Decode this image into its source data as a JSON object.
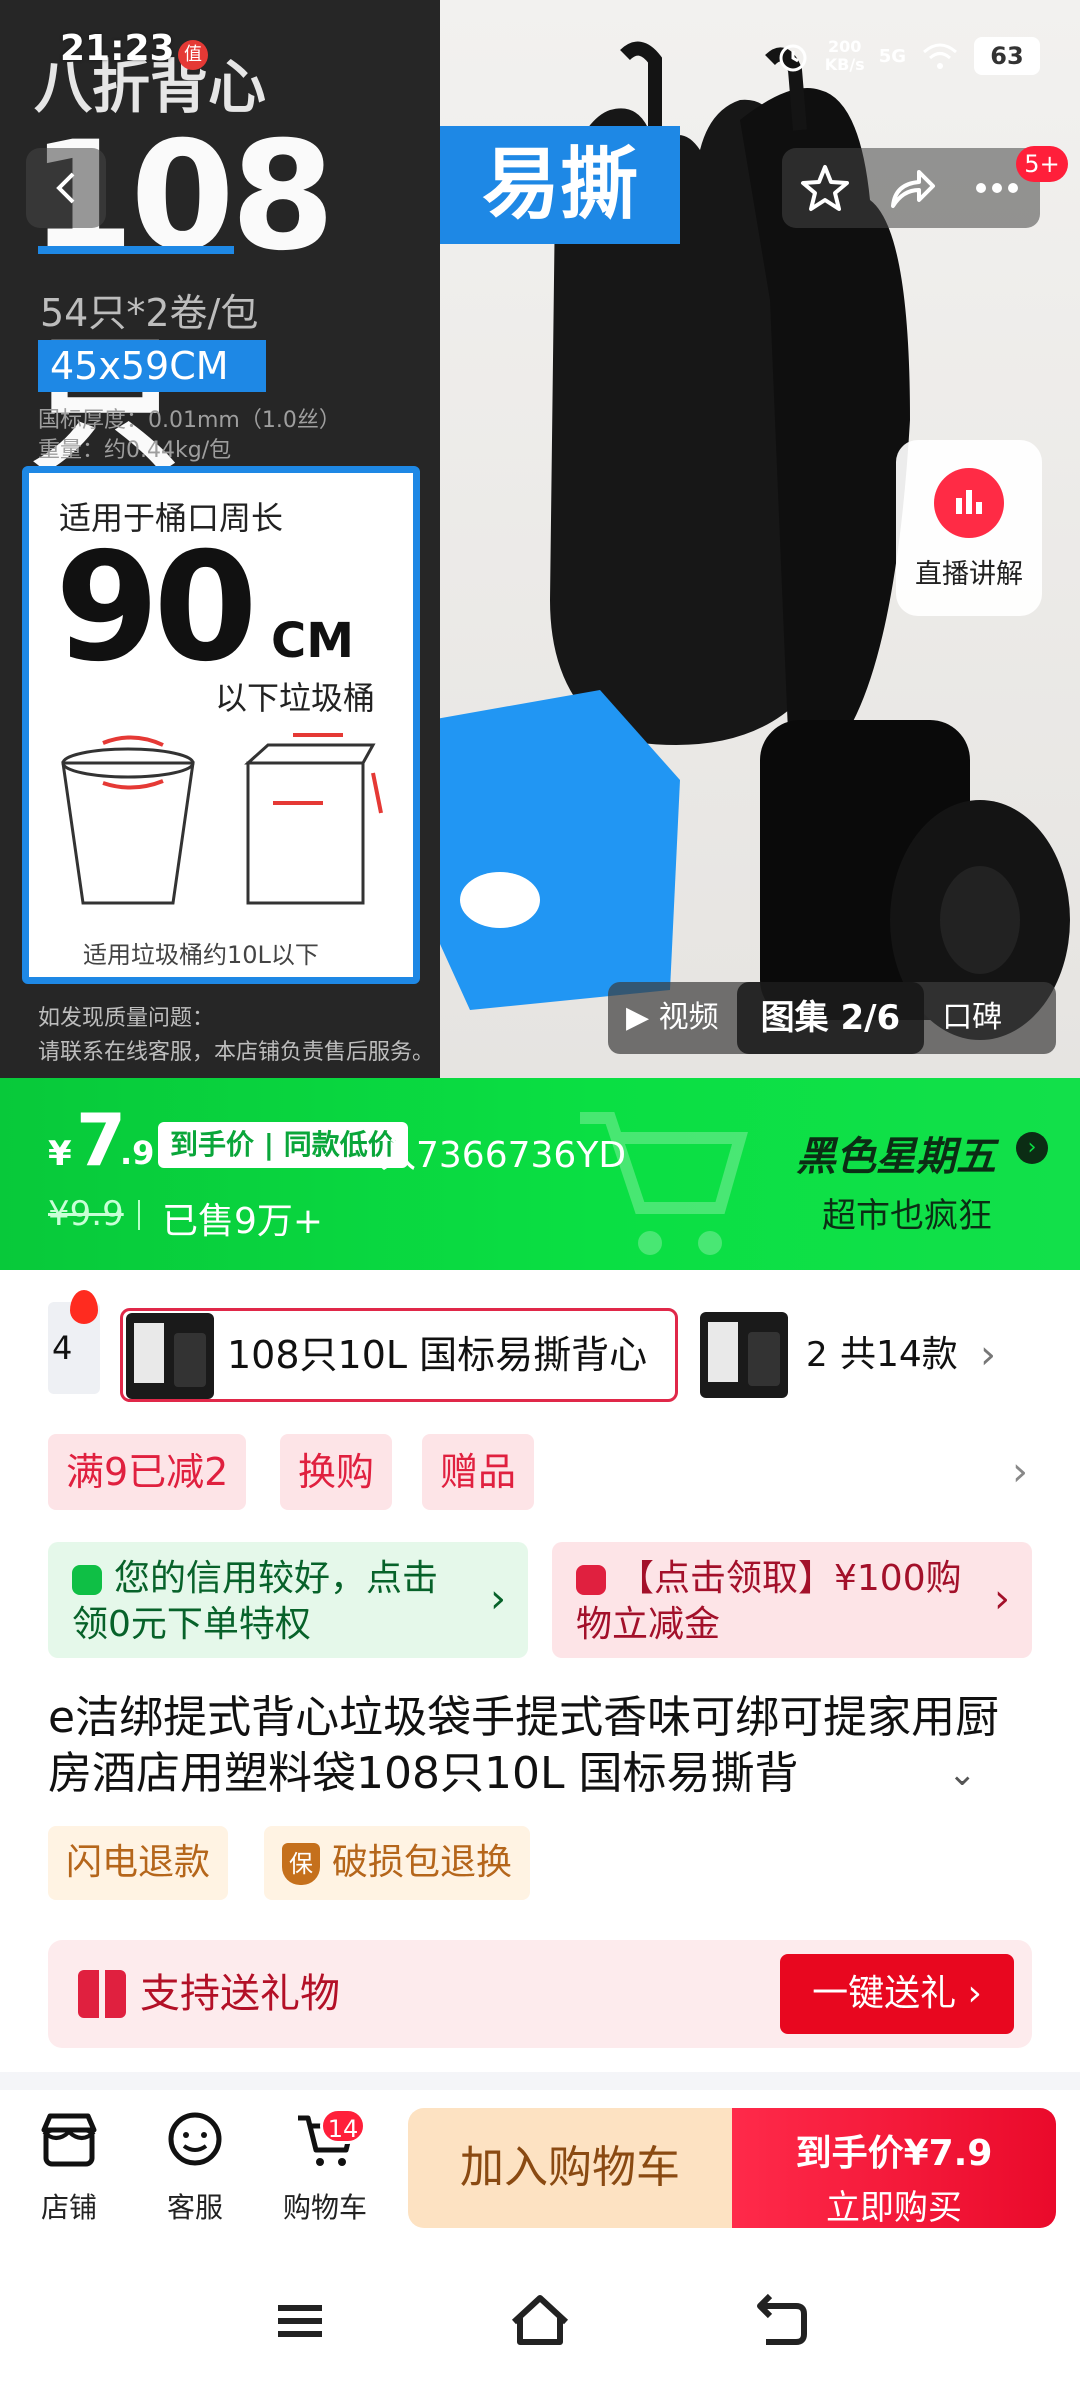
{
  "status_bar": {
    "time": "21:23",
    "badge": "值",
    "speed": "200\nKB/s",
    "network": "5G",
    "battery": "63"
  },
  "hero": {
    "left": {
      "title": "八折背心",
      "count": "108只",
      "spec": "54只*2卷/包",
      "size": "45x59CM",
      "thickness": "国标厚度：0.01mm（1.0丝）",
      "weight": "重量：约0.44kg/包",
      "card_title": "适用于桶口周长",
      "card_value": "90",
      "card_unit": "CM",
      "card_sub": "以下垃圾桶",
      "card_note": "适用垃圾桶约10L以下",
      "footer_1": "如发现质量问题：",
      "footer_2": "请联系在线客服，本店铺负责售后服务。"
    },
    "right_tag": "易撕",
    "notification_badge": "5+",
    "live_button_label": "直播讲解",
    "media_tabs": {
      "video": "视频",
      "gallery": "图集 2/6",
      "reviews": "口碑"
    }
  },
  "price_banner": {
    "currency": "¥",
    "price_int": "7",
    "price_dec": ".9",
    "tag": "到手价 | 同款低价",
    "code": "入7366736YD",
    "original_price": "¥9.9",
    "sold": "已售9万+",
    "promo_title": "黑色星期五",
    "promo_sub": "超市也疯狂"
  },
  "sku": {
    "prev_label": "4",
    "selected_label": "108只10L 国标易撕背心",
    "next_label": "2",
    "total": "共14款"
  },
  "promos": [
    {
      "label": "满9已减2"
    },
    {
      "label": "换购"
    },
    {
      "label": "赠品"
    }
  ],
  "coupons": {
    "credit": "您的信用较好，点击领0元下单特权",
    "cash": "【点击领取】¥100购物立减金"
  },
  "product": {
    "title": "e洁绑提式背心垃圾袋手提式香味可绑可提家用厨房酒店用塑料袋108只10L 国标易撕背"
  },
  "services": {
    "refund": "闪电退款",
    "guarantee_icon": "保",
    "guarantee": "破损包退换"
  },
  "gift": {
    "label": "支持送礼物",
    "button": "一键送礼 ›"
  },
  "action_bar": {
    "store": "店铺",
    "service": "客服",
    "cart": "购物车",
    "cart_count": "14",
    "add_to_cart": "加入购物车",
    "buy_price": "到手价¥7.9",
    "buy_label": "立即购买"
  },
  "colors": {
    "accent_red": "#e8071f",
    "banner_green": "#0adf43",
    "brand_blue": "#1e88e5"
  }
}
